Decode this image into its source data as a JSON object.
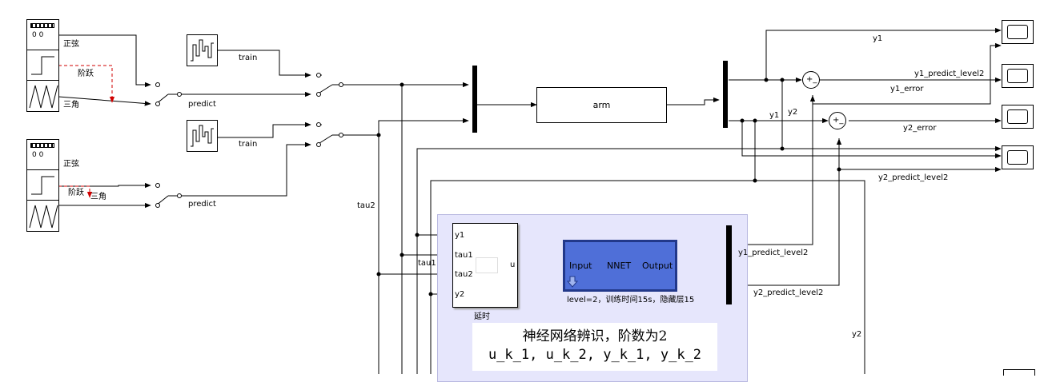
{
  "signals": {
    "sine1": "正弦",
    "step1": "阶跃",
    "tri1": "三角",
    "sine2": "正弦",
    "step2": "阶跃",
    "tri2": "三角",
    "train1": "train",
    "predict1": "predict",
    "train2": "train",
    "predict2": "predict",
    "tau2": "tau2",
    "tau1": "tau1",
    "y1": "y1",
    "y1_predict_level2": "y1_predict_level2",
    "y1_error": "y1_error",
    "y1_b": "y1",
    "y2_b": "y2",
    "y2_error": "y2_error",
    "y2_predict_level2": "y2_predict_level2",
    "y1_predict_level2_b": "y1_predict_level2",
    "y2_predict_level2_b": "y2_predict_level2",
    "y2_c": "y2"
  },
  "blocks": {
    "arm": "arm",
    "delay_label": "延时",
    "delay_ports": [
      "y1",
      "tau1",
      "tau2",
      "y2"
    ],
    "delay_out": "u",
    "nnet_input": "Input",
    "nnet_name": "NNET",
    "nnet_output": "Output",
    "nnet_caption": "level=2，训练时间15s，隐藏层15",
    "source_digits": "0 0",
    "sum_signs": "+_"
  },
  "annotation": {
    "line1": "神经网络辨识，阶数为2",
    "line2": "u_k_1, u_k_2, y_k_1, y_k_2"
  },
  "colors": {
    "subsystem_bg": "#e6e6fc",
    "nnet_fill": "#4f6fd8",
    "nnet_border": "#22388a",
    "step_wire": "#d00000"
  }
}
